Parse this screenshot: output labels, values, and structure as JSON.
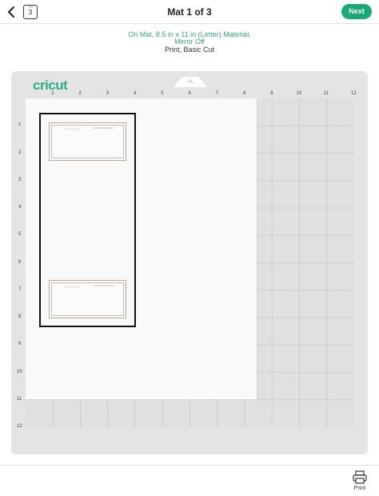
{
  "header": {
    "title": "Mat 1 of 3",
    "mat_count": "3",
    "next_label": "Next"
  },
  "material": {
    "line1": "On Mat, 8.5 in x 11 in (Letter) Material,",
    "line2": "Mirror Off",
    "cut_info": "Print, Basic Cut"
  },
  "mat": {
    "brand": "cricut",
    "top_ruler": [
      "1",
      "2",
      "3",
      "4",
      "5",
      "6",
      "7",
      "8",
      "9",
      "10",
      "11",
      "12"
    ],
    "side_ruler": [
      "1",
      "2",
      "3",
      "4",
      "5",
      "6",
      "7",
      "8",
      "9",
      "10",
      "11",
      "12"
    ]
  },
  "footer": {
    "print_label": "Print"
  },
  "colors": {
    "accent": "#1aa875",
    "brand": "#29b08a",
    "mat": "#e4e4e4"
  }
}
